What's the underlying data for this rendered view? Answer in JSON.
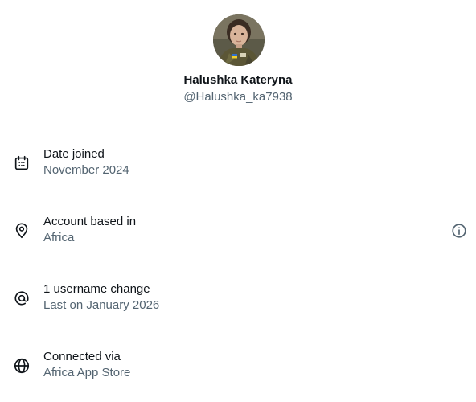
{
  "profile": {
    "name": "Halushka Kateryna",
    "handle": "@Halushka_ka7938",
    "avatar_icon": "profile-photo"
  },
  "details": [
    {
      "icon": "calendar-icon",
      "title": "Date joined",
      "value": "November 2024"
    },
    {
      "icon": "location-pin-icon",
      "title": "Account based in",
      "value": "Africa",
      "trailing_icon": "info-icon"
    },
    {
      "icon": "at-sign-icon",
      "title": "1 username change",
      "value": "Last on January 2026"
    },
    {
      "icon": "globe-icon",
      "title": "Connected via",
      "value": "Africa App Store"
    }
  ],
  "colors": {
    "primary_text": "#0f1419",
    "secondary_text": "#536471",
    "background": "#ffffff"
  }
}
